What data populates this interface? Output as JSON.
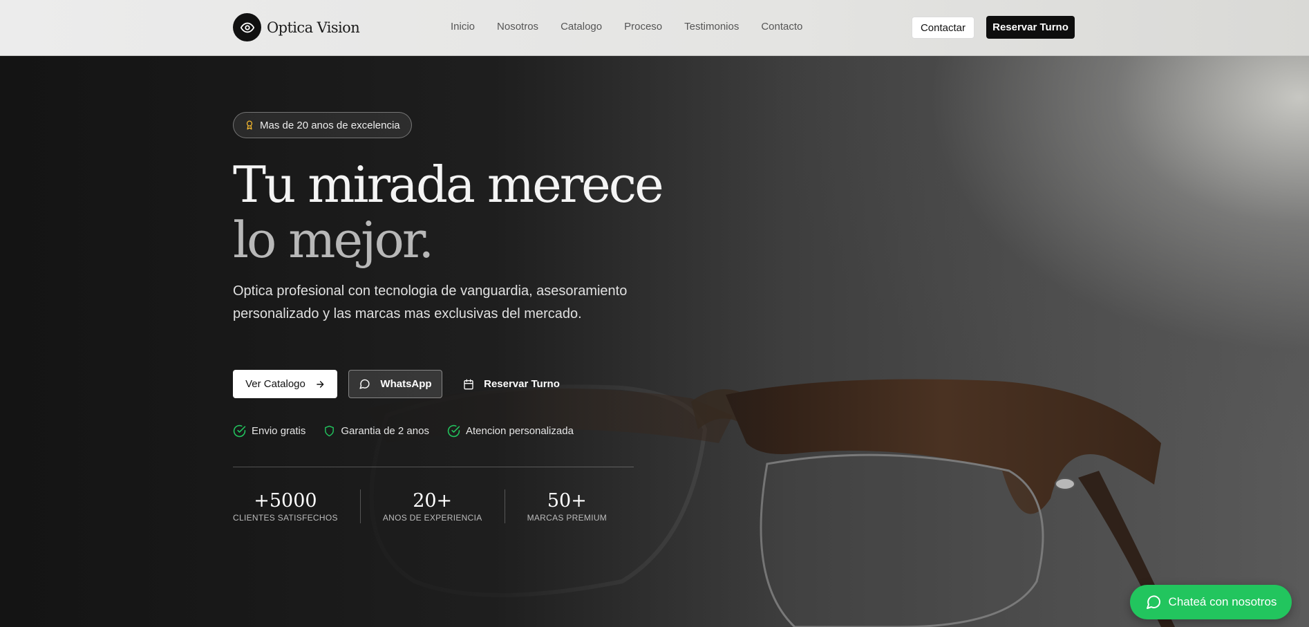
{
  "header": {
    "brand": "Optica Vision",
    "logo_icon": "eye-icon",
    "nav": [
      "Inicio",
      "Nosotros",
      "Catalogo",
      "Proceso",
      "Testimonios",
      "Contacto"
    ],
    "contact_label": "Contactar",
    "reserve_label": "Reservar Turno"
  },
  "hero": {
    "badge": "Mas de 20 anos de excelencia",
    "badge_icon": "award-icon",
    "title_line1": "Tu mirada merece",
    "title_line2": "lo mejor.",
    "description": "Optica profesional con tecnologia de vanguardia, asesoramiento personalizado y las marcas mas exclusivas del mercado.",
    "buttons": {
      "catalog": "Ver Catalogo",
      "whatsapp": "WhatsApp",
      "reserve": "Reservar Turno"
    },
    "features": [
      {
        "label": "Envio gratis",
        "icon": "check-circle-icon"
      },
      {
        "label": "Garantia de 2 anos",
        "icon": "shield-icon"
      },
      {
        "label": "Atencion personalizada",
        "icon": "check-circle-icon"
      }
    ],
    "stats": [
      {
        "value": "+5000",
        "label": "CLIENTES SATISFECHOS"
      },
      {
        "value": "20+",
        "label": "ANOS DE EXPERIENCIA"
      },
      {
        "value": "50+",
        "label": "MARCAS PREMIUM"
      }
    ]
  },
  "chat_button": "Chateá con nosotros",
  "colors": {
    "accent_green": "#22c55e",
    "badge_gold": "#f5b82e",
    "dark": "#0e0e0e"
  }
}
